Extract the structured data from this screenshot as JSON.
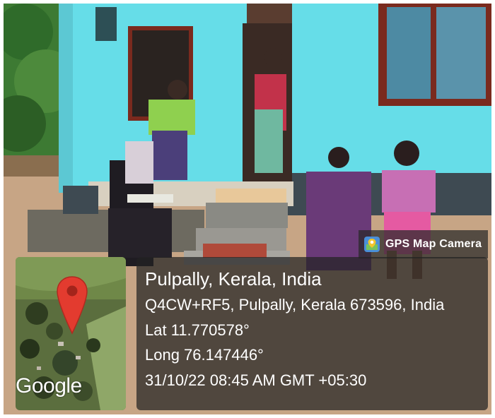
{
  "photo": {
    "description_icon": "camera-photo",
    "colors": {
      "wall": "#66dde8",
      "ground": "#c9a88a",
      "trees": "#2f6b2a",
      "overlay": "#232323"
    }
  },
  "badge": {
    "icon": "map-pin-camera-icon",
    "text": "GPS Map Camera"
  },
  "map": {
    "pin_icon": "location-pin-icon",
    "pin_color": "#e33b2f",
    "logo_text": "Google"
  },
  "info": {
    "place": "Pulpally, Kerala, India",
    "address": "Q4CW+RF5, Pulpally, Kerala 673596, India",
    "lat": "Lat 11.770578°",
    "long": "Long 76.147446°",
    "datetime": "31/10/22 08:45 AM GMT +05:30"
  }
}
